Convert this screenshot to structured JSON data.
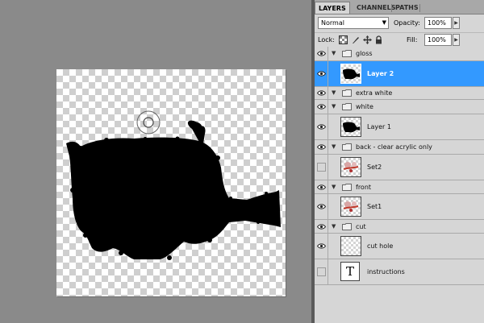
{
  "panel": {
    "tabs": [
      {
        "label": "LAYERS",
        "active": true
      },
      {
        "label": "CHANNELS",
        "active": false
      },
      {
        "label": "PATHS",
        "active": false
      }
    ],
    "blend_mode": "Normal",
    "opacity_label": "Opacity:",
    "opacity_value": "100%",
    "lock_label": "Lock:",
    "fill_label": "Fill:",
    "fill_value": "100%",
    "lock_icons": [
      "lock-transparency-icon",
      "lock-paint-icon",
      "lock-position-icon",
      "lock-all-icon"
    ]
  },
  "layers": [
    {
      "kind": "group",
      "name": "gloss",
      "visible": true,
      "expanded": true
    },
    {
      "kind": "layer",
      "name": "Layer 2",
      "visible": true,
      "selected": true,
      "thumb": "black-shape"
    },
    {
      "kind": "group",
      "name": "extra white",
      "visible": true,
      "expanded": true
    },
    {
      "kind": "group",
      "name": "white",
      "visible": true,
      "expanded": true
    },
    {
      "kind": "layer",
      "name": "Layer 1",
      "visible": true,
      "selected": false,
      "thumb": "black-shape"
    },
    {
      "kind": "group",
      "name": "back - clear acrylic only",
      "visible": true,
      "expanded": true
    },
    {
      "kind": "layer",
      "name": "Set2",
      "visible": false,
      "selected": false,
      "thumb": "artwork"
    },
    {
      "kind": "group",
      "name": "front",
      "visible": true,
      "expanded": true
    },
    {
      "kind": "layer",
      "name": "Set1",
      "visible": true,
      "selected": false,
      "thumb": "artwork"
    },
    {
      "kind": "group",
      "name": "cut",
      "visible": true,
      "expanded": true
    },
    {
      "kind": "layer",
      "name": "cut hole",
      "visible": true,
      "selected": false,
      "thumb": "transparent"
    },
    {
      "kind": "text",
      "name": "instructions",
      "visible": false,
      "selected": false,
      "thumb_glyph": "T"
    }
  ],
  "colors": {
    "selection": "#3399ff",
    "workspace": "#8a8a8a",
    "panel": "#d6d6d6",
    "silhouette": "#000000"
  }
}
